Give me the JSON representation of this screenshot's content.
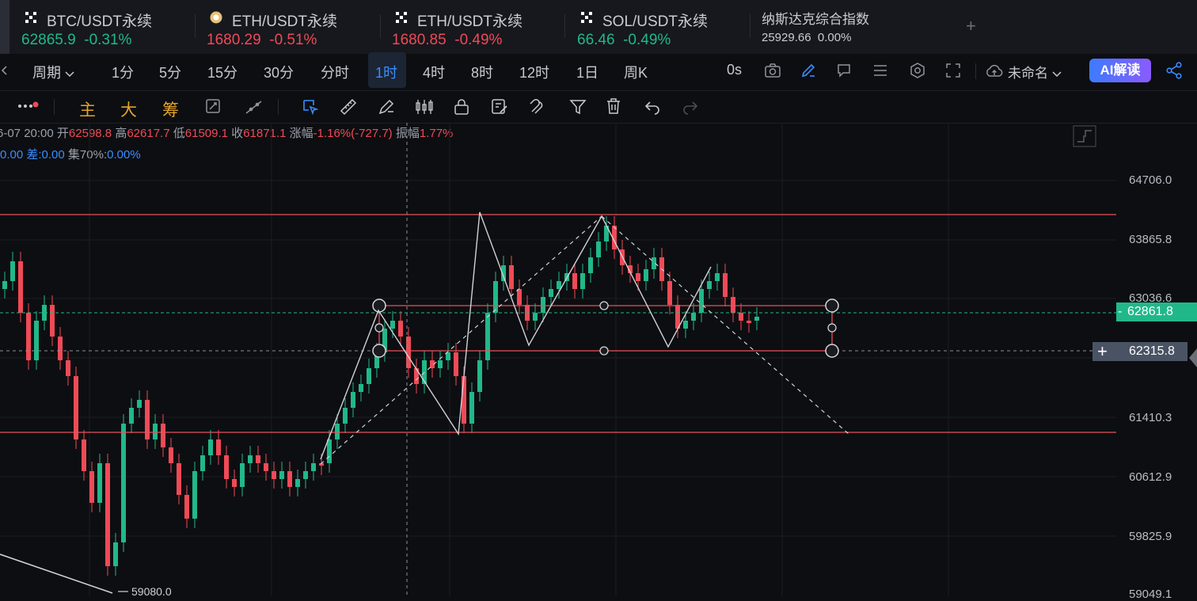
{
  "tickers": [
    {
      "name": "BTC/USDT永续",
      "price": "62865.9",
      "change": "-0.31%",
      "price_color": "green"
    },
    {
      "name": "ETH/USDT永续",
      "price": "1680.29",
      "change": "-0.51%",
      "price_color": "red"
    },
    {
      "name": "ETH/USDT永续",
      "price": "1680.85",
      "change": "-0.49%",
      "price_color": "red"
    },
    {
      "name": "SOL/USDT永续",
      "price": "66.46",
      "change": "-0.49%",
      "price_color": "green"
    },
    {
      "name": "纳斯达克综合指数",
      "price": "25929.66",
      "change": "0.00%",
      "price_color": "neutral"
    }
  ],
  "timeframes": {
    "period_label": "周期",
    "items": [
      "1分",
      "5分",
      "15分",
      "30分",
      "分时",
      "1时",
      "4时",
      "8时",
      "12时",
      "1日",
      "周K"
    ],
    "selected": "1时",
    "countdown": "0s"
  },
  "toolbar": {
    "layout_name": "未命名",
    "ai_label": "AI解读"
  },
  "drawbar": {
    "main": "主",
    "big": "大",
    "chips": "筹"
  },
  "ohlc": {
    "date": "6-07 20:00",
    "open_label": "开",
    "open": "62598.8",
    "high_label": "高",
    "high": "62617.7",
    "low_label": "低",
    "low": "61509.1",
    "close_label": "收",
    "close": "61871.1",
    "change_label": "涨幅",
    "change": "-1.16%(-727.7)",
    "amp_label": "振幅",
    "amp": "1.77%"
  },
  "indicator": {
    "lead": "0.00",
    "diff_label": "差:",
    "diff": "0.00",
    "ji_label": "集70%:",
    "ji": "0.00%"
  },
  "y_axis": {
    "labels": [
      "64706.0",
      "63865.8",
      "63036.6",
      "61410.3",
      "60612.9",
      "59825.9",
      "59049.1"
    ]
  },
  "price_tags": {
    "current": "62861.8",
    "crosshair": "62315.8"
  },
  "low_marker": "59080.0",
  "colors": {
    "up": "#21b889",
    "down": "#ef4a57",
    "accent": "#3a8dff"
  }
}
